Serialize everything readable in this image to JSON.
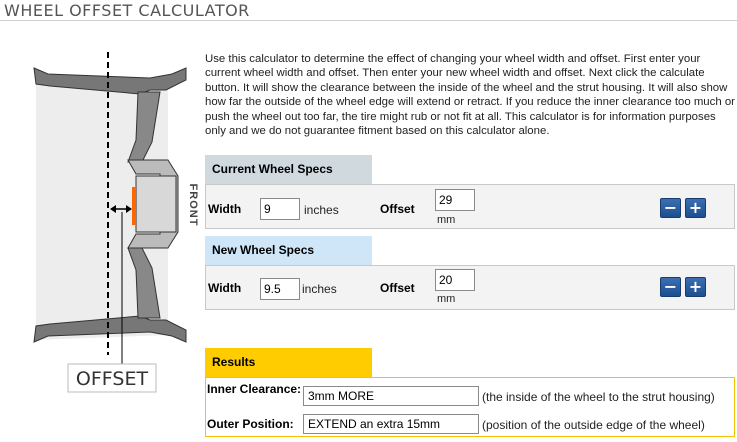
{
  "page": {
    "title": "WHEEL OFFSET CALCULATOR",
    "description": "Use this calculator to determine the effect of changing your wheel width and offset. First enter your current wheel width and offset. Then enter your new wheel width and offset. Next click the calculate button. It will show the clearance between the inside of the wheel and the strut housing. It will also show how far the outside of the wheel edge will extend or retract. If you reduce the inner clearance too much or push the wheel out too far, the tire might rub or not fit at all. This calculator is for information purposes only and we do not guarantee fitment based on this calculator alone."
  },
  "diagram": {
    "front_label": "FRONT",
    "offset_label": "OFFSET"
  },
  "current": {
    "header": "Current Wheel Specs",
    "width_label": "Width",
    "width_value": "9",
    "width_unit": "inches",
    "offset_label": "Offset",
    "offset_value": "29",
    "offset_unit": "mm",
    "minus": "−",
    "plus": "+"
  },
  "new": {
    "header": "New Wheel Specs",
    "width_label": "Width",
    "width_value": "9.5",
    "width_unit": "inches",
    "offset_label": "Offset",
    "offset_value": "20",
    "offset_unit": "mm",
    "minus": "−",
    "plus": "+"
  },
  "results": {
    "header": "Results",
    "inner_label": "Inner Clearance:",
    "inner_value": "3mm MORE",
    "inner_note": "(the inside of the wheel to the strut housing)",
    "outer_label": "Outer Position:",
    "outer_value": "EXTEND an extra 15mm",
    "outer_note": "(position of the outside edge of the wheel)"
  },
  "colors": {
    "current_header": "#d0d9dd",
    "new_header": "#cfe6f9",
    "results_header": "#ffcc00",
    "button_blue": "#2a5ba0",
    "mounting_pad": "#ff6600"
  }
}
